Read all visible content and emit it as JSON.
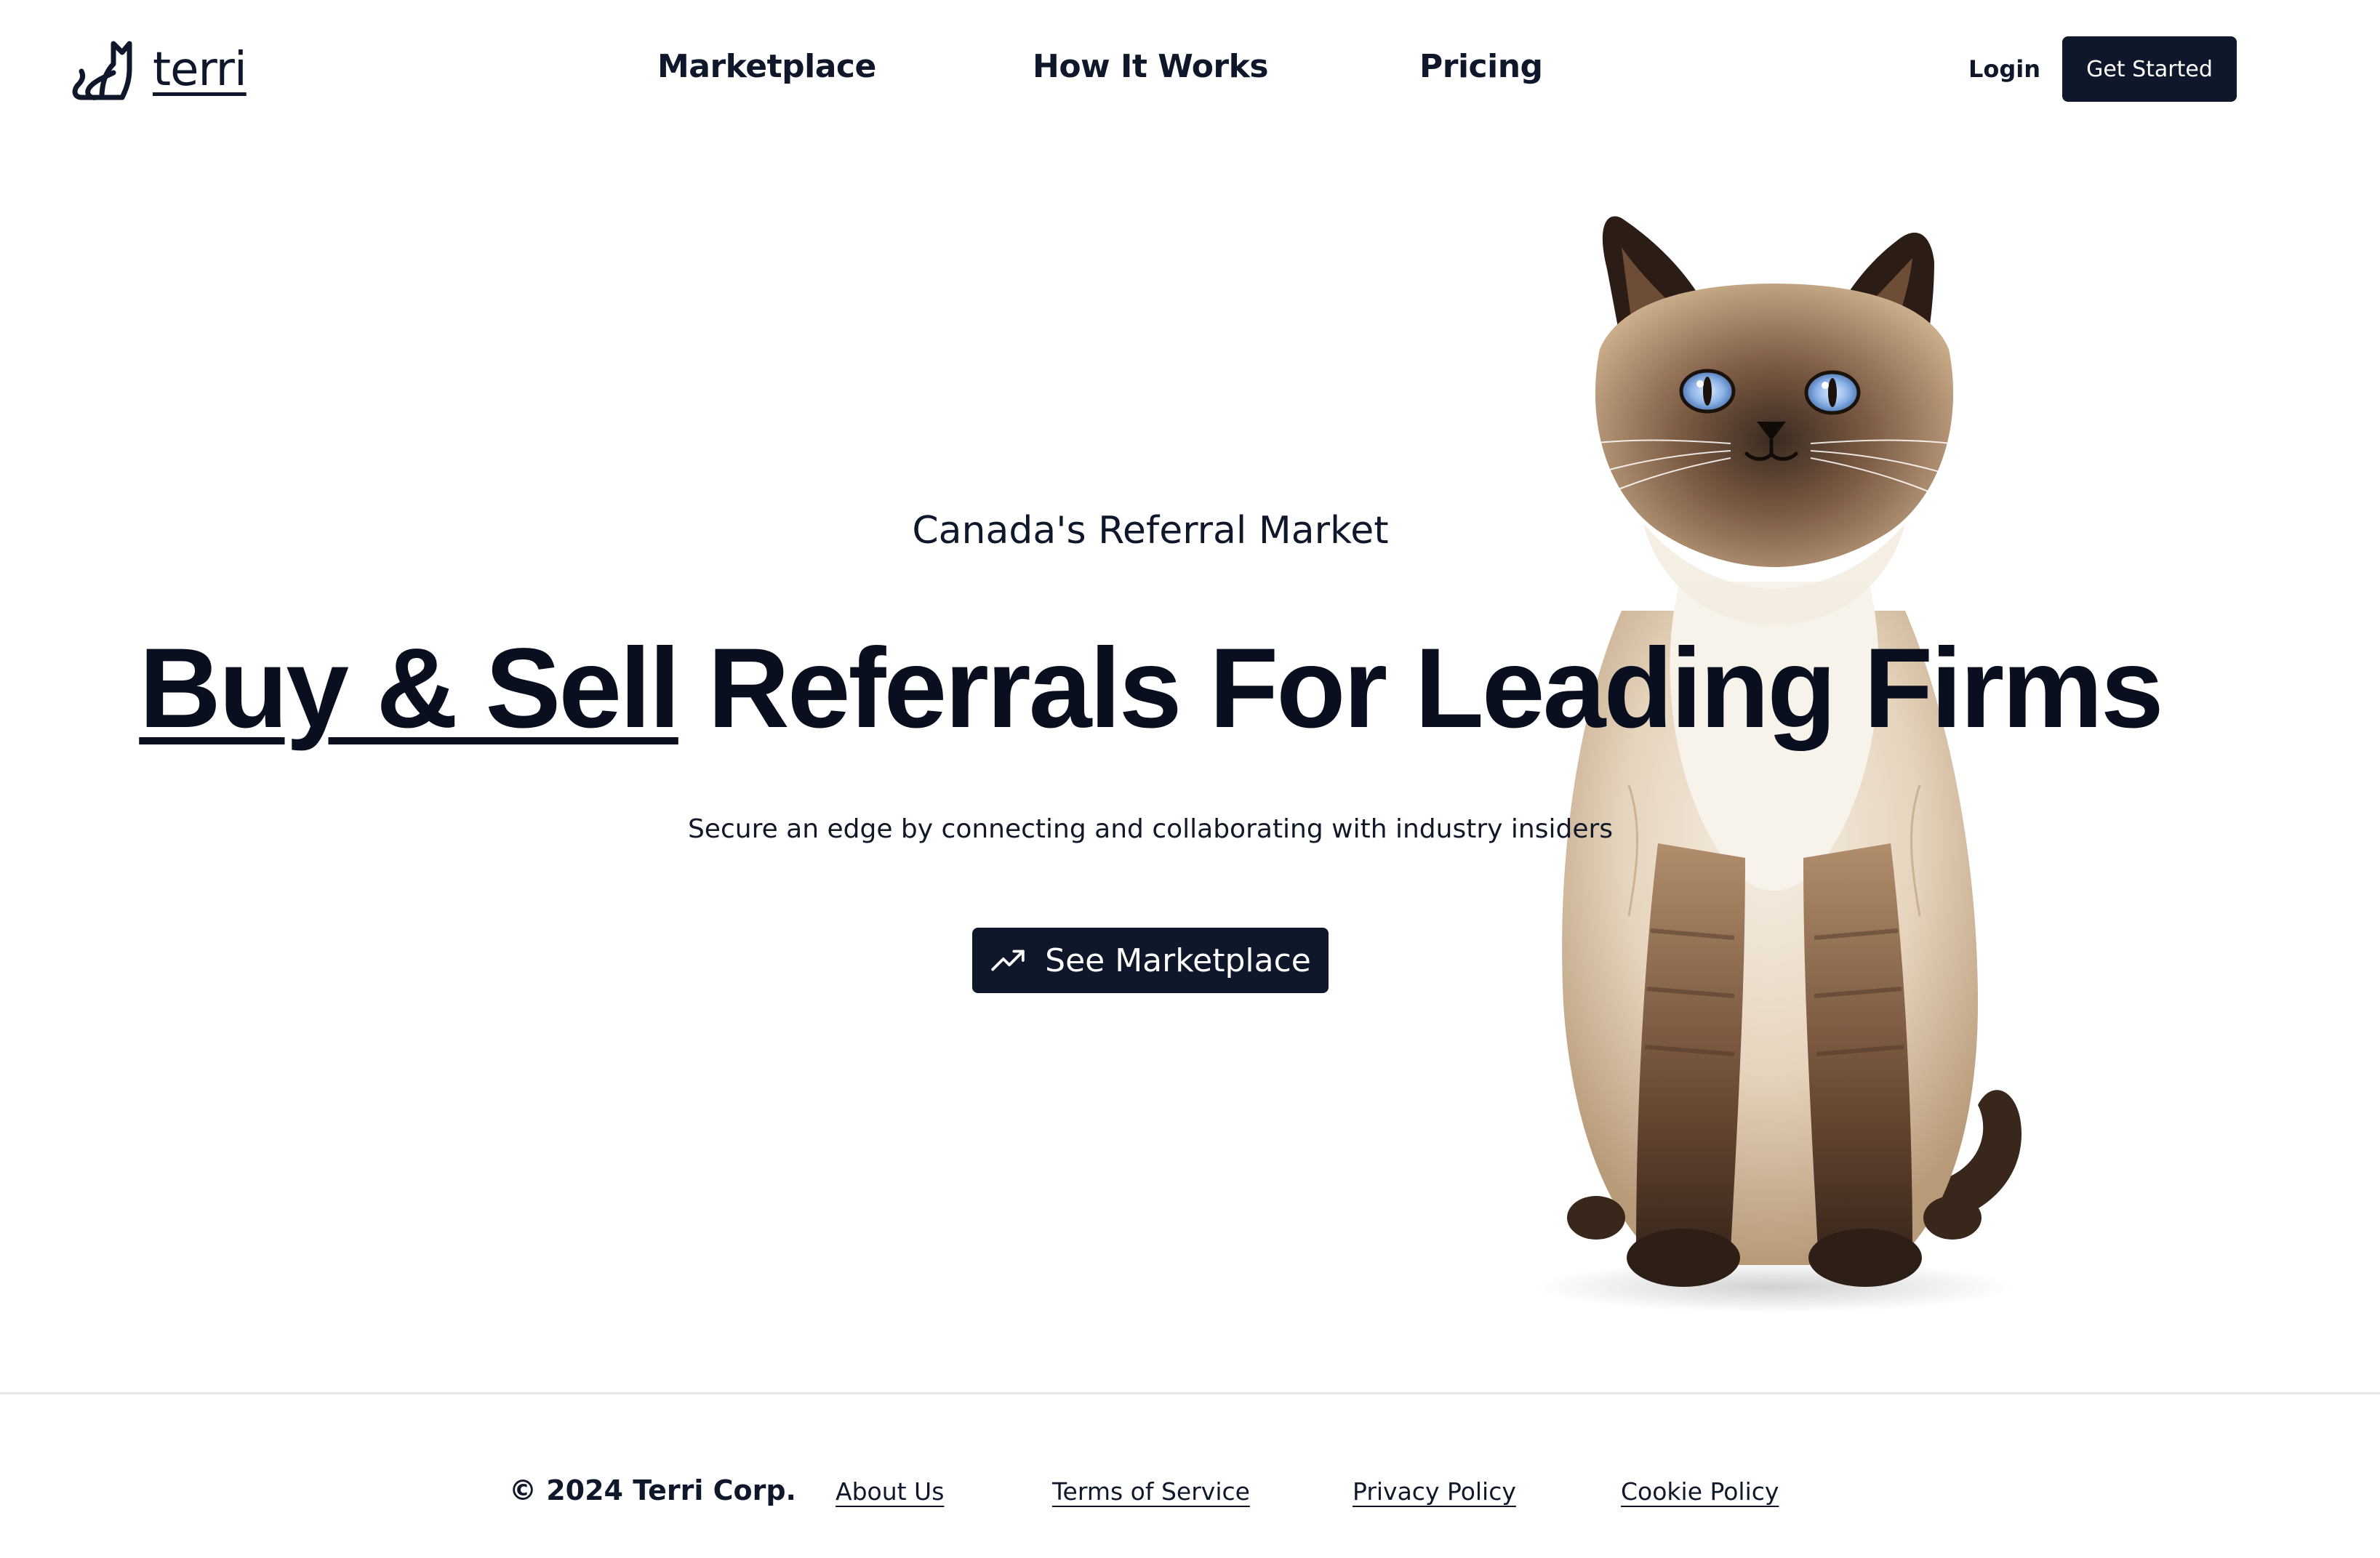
{
  "header": {
    "logo_text": "terri",
    "nav": [
      {
        "label": "Marketplace"
      },
      {
        "label": "How It Works"
      },
      {
        "label": "Pricing"
      }
    ],
    "login_label": "Login",
    "get_started_label": "Get Started"
  },
  "hero": {
    "eyebrow": "Canada's Referral Market",
    "title_accent": "Buy & Sell",
    "title_rest": " Referrals For Leading Firms",
    "subtitle": "Secure an edge by connecting and collaborating with industry insiders",
    "cta_label": "See Marketplace",
    "cta_icon": "trending-up-icon",
    "image": "siamese-cat"
  },
  "footer": {
    "copyright": "© 2024 Terri Corp.",
    "links": [
      {
        "label": "About Us"
      },
      {
        "label": "Terms of Service"
      },
      {
        "label": "Privacy Policy"
      },
      {
        "label": "Cookie Policy"
      }
    ]
  },
  "colors": {
    "primary": "#0f172a",
    "background": "#ffffff",
    "divider": "#e5e7eb"
  }
}
